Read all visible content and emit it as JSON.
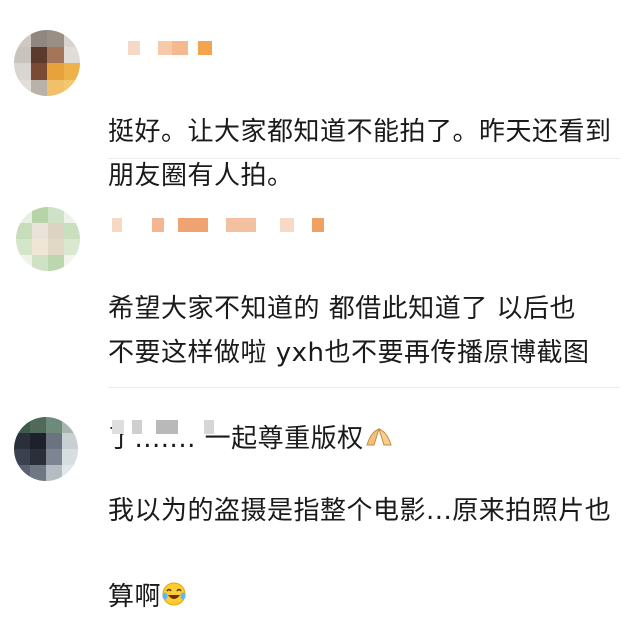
{
  "comments": [
    {
      "text": "挺好。让大家都知道不能拍了。昨天还看到\n朋友圈有人拍。",
      "emoji": ""
    },
    {
      "text": "希望大家不知道的 都借此知道了 以后也\n不要这样做啦 yxh也不要再传播原博截图\n了....... 一起尊重版权",
      "emoji": "pray-hands-icon"
    },
    {
      "text": "我以为的盗摄是指整个电影...原来拍照片也\n算啊",
      "emoji": "laughing-tears-icon"
    }
  ]
}
